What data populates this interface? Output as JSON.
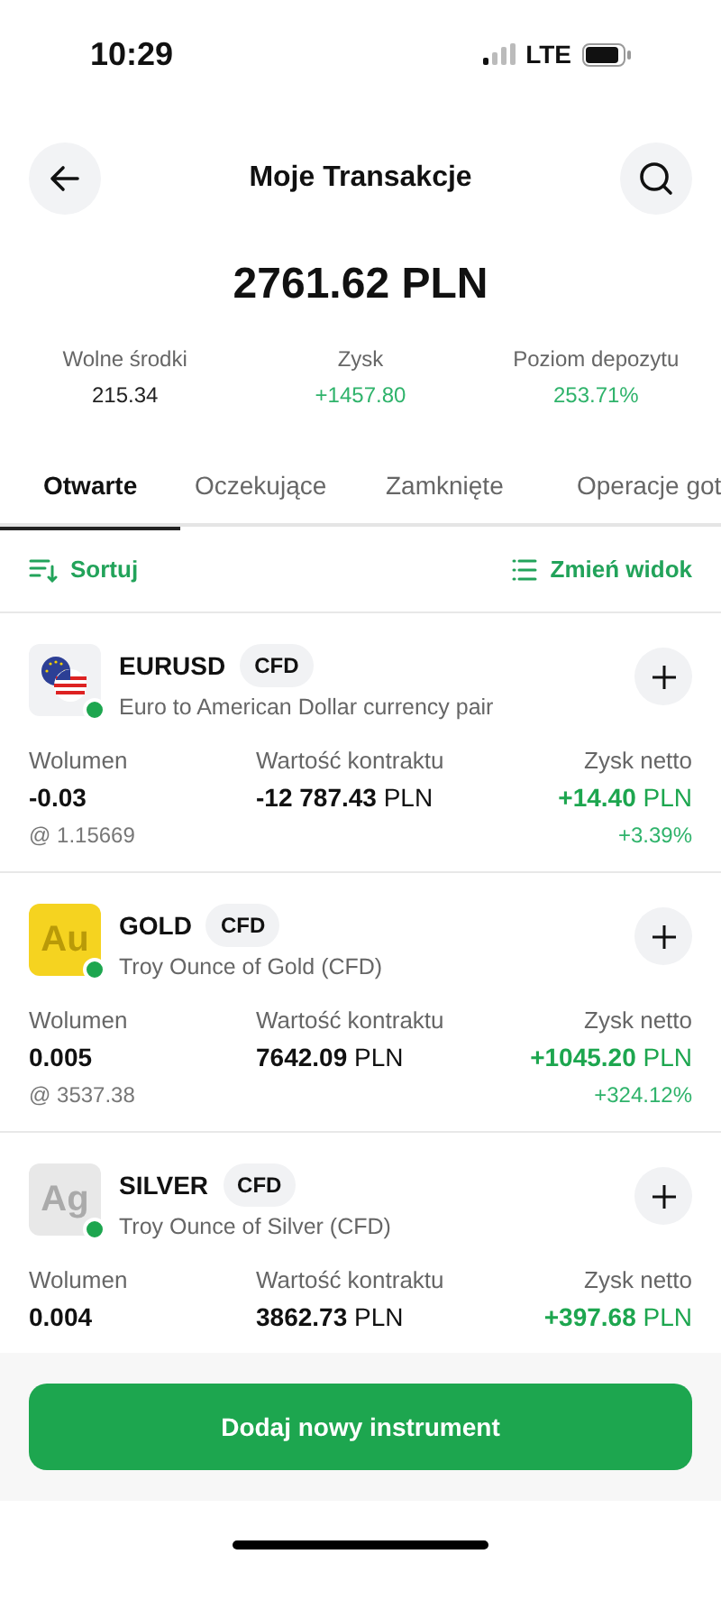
{
  "status_bar": {
    "time": "10:29",
    "network": "LTE"
  },
  "header": {
    "title": "Moje Transakcje"
  },
  "summary": {
    "total": "2761.62 PLN",
    "stats": [
      {
        "label": "Wolne środki",
        "value": "215.34",
        "positive": false
      },
      {
        "label": "Zysk",
        "value": "+1457.80",
        "positive": true
      },
      {
        "label": "Poziom depozytu",
        "value": "253.71%",
        "positive": true
      }
    ]
  },
  "tabs": [
    {
      "label": "Otwarte",
      "selected": true
    },
    {
      "label": "Oczekujące",
      "selected": false
    },
    {
      "label": "Zamknięte",
      "selected": false
    },
    {
      "label": "Operacje got",
      "selected": false
    }
  ],
  "toolbar": {
    "sort": "Sortuj",
    "view": "Zmień widok"
  },
  "positions": [
    {
      "kind": "flags",
      "symbol": "EURUSD",
      "badge": "CFD",
      "description": "Euro to American Dollar currency pair",
      "market_open": true,
      "volume_label": "Wolumen",
      "volume": "-0.03",
      "price": "@ 1.15669",
      "value_label": "Wartość kontraktu",
      "value": "**-12 787.43** PLN",
      "profit_label": "Zysk netto",
      "profit": "**+14.40** PLN",
      "profit_pct": "+3.39%"
    },
    {
      "kind": "gold",
      "logo_text": "Au",
      "symbol": "GOLD",
      "badge": "CFD",
      "description": "Troy Ounce of Gold (CFD)",
      "market_open": true,
      "volume_label": "Wolumen",
      "volume": "0.005",
      "price": "@ 3537.38",
      "value_label": "Wartość kontraktu",
      "value": "**7642.09** PLN",
      "profit_label": "Zysk netto",
      "profit": "**+1045.20** PLN",
      "profit_pct": "+324.12%"
    },
    {
      "kind": "silver",
      "logo_text": "Ag",
      "symbol": "SILVER",
      "badge": "CFD",
      "description": "Troy Ounce of Silver (CFD)",
      "market_open": true,
      "volume_label": "Wolumen",
      "volume": "0.004",
      "value_label": "Wartość kontraktu",
      "value": "**3862.73** PLN",
      "profit_label": "Zysk netto",
      "profit": "**+397.68** PLN"
    }
  ],
  "footer": {
    "button": "Dodaj nowy instrument"
  }
}
